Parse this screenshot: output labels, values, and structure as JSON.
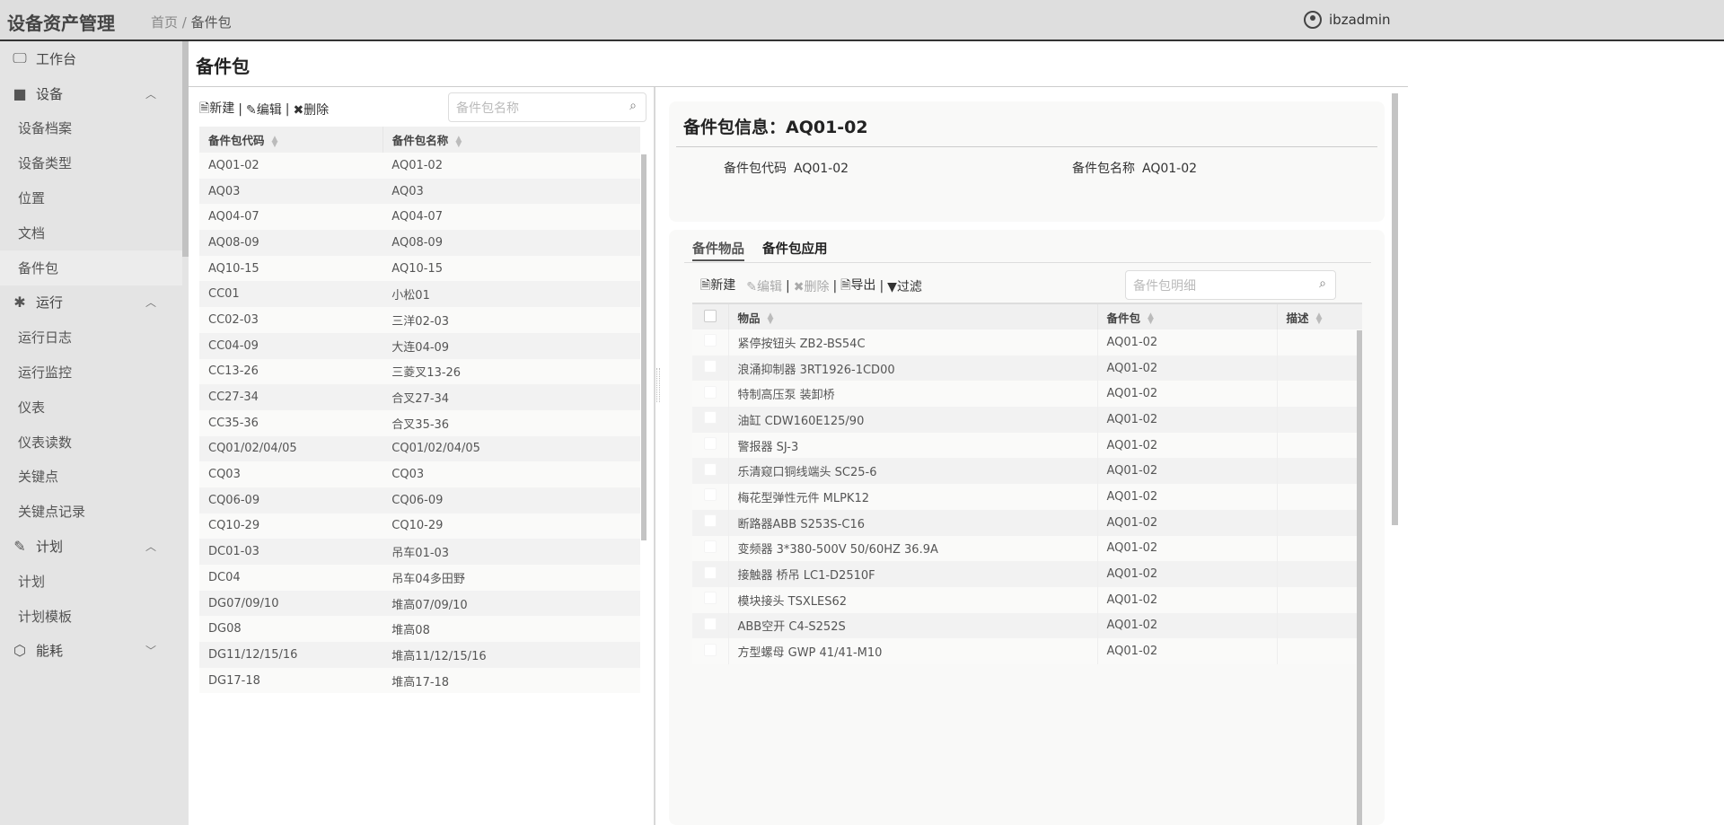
{
  "header": {
    "app_title": "设备资产管理",
    "breadcrumb": [
      "首页",
      "备件包"
    ],
    "user": "ibzadmin"
  },
  "sidebar": {
    "items": [
      {
        "label": "工作台",
        "type": "group",
        "icon": "monitor-icon",
        "glyph": "🖵"
      },
      {
        "label": "设备",
        "type": "group",
        "icon": "video-camera-icon",
        "glyph": "■",
        "expanded": true
      },
      {
        "label": "设备档案"
      },
      {
        "label": "设备类型"
      },
      {
        "label": "位置"
      },
      {
        "label": "文档"
      },
      {
        "label": "备件包",
        "active": true
      },
      {
        "label": "运行",
        "type": "group",
        "icon": "bug-icon",
        "glyph": "✱",
        "expanded": true
      },
      {
        "label": "运行日志"
      },
      {
        "label": "运行监控"
      },
      {
        "label": "仪表"
      },
      {
        "label": "仪表读数"
      },
      {
        "label": "关键点"
      },
      {
        "label": "关键点记录"
      },
      {
        "label": "计划",
        "type": "group",
        "icon": "edit-icon",
        "glyph": "✎",
        "expanded": true
      },
      {
        "label": "计划"
      },
      {
        "label": "计划模板"
      },
      {
        "label": "能耗",
        "type": "group",
        "icon": "cube-icon",
        "glyph": "⬡",
        "expanded": false
      }
    ]
  },
  "page": {
    "title": "备件包"
  },
  "left": {
    "toolbar": {
      "new": "新建",
      "edit": "编辑",
      "delete": "删除",
      "sep": "|"
    },
    "search_placeholder": "备件包名称",
    "columns": [
      "备件包代码",
      "备件包名称"
    ],
    "rows": [
      [
        "AQ01-02",
        "AQ01-02"
      ],
      [
        "AQ03",
        "AQ03"
      ],
      [
        "AQ04-07",
        "AQ04-07"
      ],
      [
        "AQ08-09",
        "AQ08-09"
      ],
      [
        "AQ10-15",
        "AQ10-15"
      ],
      [
        "CC01",
        "小松01"
      ],
      [
        "CC02-03",
        "三洋02-03"
      ],
      [
        "CC04-09",
        "大连04-09"
      ],
      [
        "CC13-26",
        "三菱叉13-26"
      ],
      [
        "CC27-34",
        "合叉27-34"
      ],
      [
        "CC35-36",
        "合叉35-36"
      ],
      [
        "CQ01/02/04/05",
        "CQ01/02/04/05"
      ],
      [
        "CQ03",
        "CQ03"
      ],
      [
        "CQ06-09",
        "CQ06-09"
      ],
      [
        "CQ10-29",
        "CQ10-29"
      ],
      [
        "DC01-03",
        "吊车01-03"
      ],
      [
        "DC04",
        "吊车04多田野"
      ],
      [
        "DG07/09/10",
        "堆高07/09/10"
      ],
      [
        "DG08",
        "堆高08"
      ],
      [
        "DG11/12/15/16",
        "堆高11/12/15/16"
      ],
      [
        "DG17-18",
        "堆高17-18"
      ]
    ]
  },
  "info": {
    "title": "备件包信息：AQ01-02",
    "fields": [
      {
        "label": "备件包代码",
        "value": "AQ01-02"
      },
      {
        "label": "备件包名称",
        "value": "AQ01-02"
      }
    ]
  },
  "detail": {
    "tabs": [
      "备件物品",
      "备件包应用"
    ],
    "toolbar": {
      "new": "新建",
      "edit": "编辑",
      "delete": "删除",
      "export": "导出",
      "filter": "过滤",
      "sep": "|"
    },
    "search_placeholder": "备件包明细",
    "columns": [
      "物品",
      "备件包",
      "描述"
    ],
    "rows": [
      [
        "紧停按钮头 ZB2-BS54C",
        "AQ01-02",
        ""
      ],
      [
        "浪涌抑制器 3RT1926-1CD00",
        "AQ01-02",
        ""
      ],
      [
        "特制高压泵 装卸桥",
        "AQ01-02",
        ""
      ],
      [
        "油缸 CDW160E125/90",
        "AQ01-02",
        ""
      ],
      [
        "警报器 SJ-3",
        "AQ01-02",
        ""
      ],
      [
        "乐清窥口铜线端头 SC25-6",
        "AQ01-02",
        ""
      ],
      [
        "梅花型弹性元件 MLPK12",
        "AQ01-02",
        ""
      ],
      [
        "断路器ABB S253S-C16",
        "AQ01-02",
        ""
      ],
      [
        "变频器 3*380-500V 50/60HZ 36.9A",
        "AQ01-02",
        ""
      ],
      [
        "接触器 桥吊 LC1-D2510F",
        "AQ01-02",
        ""
      ],
      [
        "模块接头 TSXLES62",
        "AQ01-02",
        ""
      ],
      [
        "ABB空开 C4-S252S",
        "AQ01-02",
        ""
      ],
      [
        "方型螺母 GWP 41/41-M10",
        "AQ01-02",
        ""
      ]
    ]
  },
  "colors": {
    "link": "#2a8fd8",
    "header_bg": "#dedede",
    "sidebar_bg": "#e4e4e4"
  }
}
